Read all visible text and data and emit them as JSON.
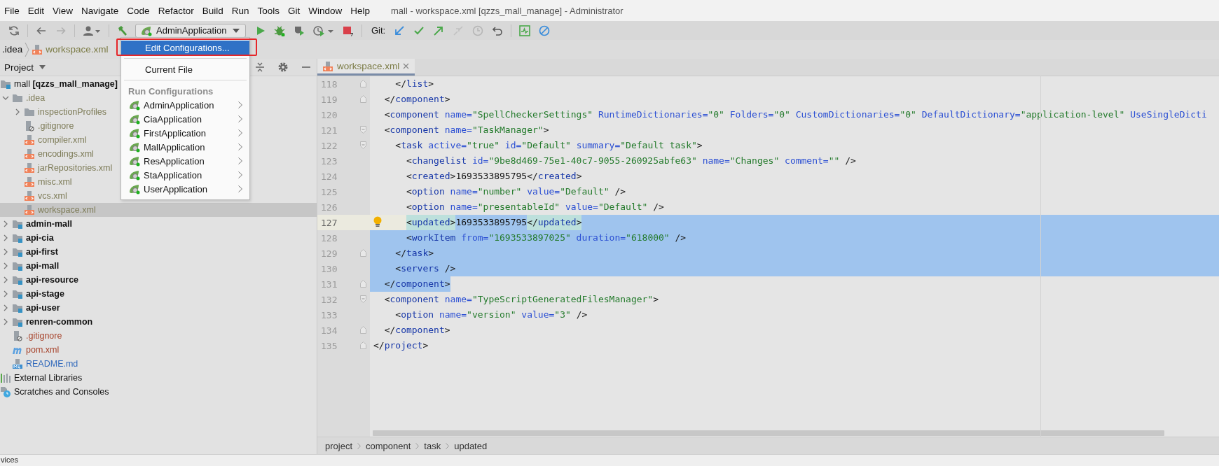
{
  "window": {
    "title": "mall - workspace.xml [qzzs_mall_manage] - Administrator"
  },
  "menu_bar": [
    "File",
    "Edit",
    "View",
    "Navigate",
    "Code",
    "Refactor",
    "Build",
    "Run",
    "Tools",
    "Git",
    "Window",
    "Help"
  ],
  "toolbar": {
    "run_configuration": "AdminApplication",
    "git_label": "Git:"
  },
  "navigation_bar": [
    {
      "kind": "folder",
      "label": ".idea"
    },
    {
      "kind": "xml",
      "label": "workspace.xml"
    }
  ],
  "project_panel": {
    "title": "Project",
    "tree": [
      {
        "kind": "root",
        "label": "mall **[qzzs_mall_manage]**",
        "color": "#111111",
        "expanded": true,
        "selected": false,
        "children": [
          {
            "kind": "folder",
            "label": ".idea",
            "color": "#7d7b57",
            "expanded": true,
            "selected": false,
            "children": [
              {
                "kind": "folder",
                "label": "inspectionProfiles",
                "color": "#7d7b57",
                "expanded": false,
                "selected": false
              },
              {
                "kind": "ignore-file",
                "label": ".gitignore",
                "color": "#7d7b57",
                "selected": false
              },
              {
                "kind": "xml",
                "label": "compiler.xml",
                "color": "#7d7b57",
                "selected": false
              },
              {
                "kind": "xml",
                "label": "encodings.xml",
                "color": "#7d7b57",
                "selected": false
              },
              {
                "kind": "xml",
                "label": "jarRepositories.xml",
                "color": "#7d7b57",
                "selected": false
              },
              {
                "kind": "xml",
                "label": "misc.xml",
                "color": "#7d7b57",
                "selected": false
              },
              {
                "kind": "xml",
                "label": "vcs.xml",
                "color": "#7d7b57",
                "selected": false
              },
              {
                "kind": "xml",
                "label": "workspace.xml",
                "color": "#7d7b57",
                "selected": true
              }
            ]
          },
          {
            "kind": "module",
            "label": "admin-mall",
            "color": "#111111",
            "expanded": false,
            "selected": false
          },
          {
            "kind": "module",
            "label": "api-cia",
            "color": "#111111",
            "expanded": false,
            "selected": false
          },
          {
            "kind": "module",
            "label": "api-first",
            "color": "#111111",
            "expanded": false,
            "selected": false
          },
          {
            "kind": "module",
            "label": "api-mall",
            "color": "#111111",
            "expanded": false,
            "selected": false
          },
          {
            "kind": "module",
            "label": "api-resource",
            "color": "#111111",
            "expanded": false,
            "selected": false
          },
          {
            "kind": "module",
            "label": "api-stage",
            "color": "#111111",
            "expanded": false,
            "selected": false
          },
          {
            "kind": "module",
            "label": "api-user",
            "color": "#111111",
            "expanded": false,
            "selected": false
          },
          {
            "kind": "module",
            "label": "renren-common",
            "color": "#111111",
            "expanded": false,
            "selected": false
          },
          {
            "kind": "ignore-file",
            "label": ".gitignore",
            "color": "#a7432b",
            "selected": false
          },
          {
            "kind": "maven",
            "label": "pom.xml",
            "color": "#a7432b",
            "selected": false
          },
          {
            "kind": "markdown",
            "label": "README.md",
            "color": "#2f68bb",
            "selected": false
          }
        ]
      },
      {
        "kind": "libraries",
        "label": "External Libraries",
        "color": "#111111",
        "selected": false
      },
      {
        "kind": "scratches",
        "label": "Scratches and Consoles",
        "color": "#111111",
        "selected": false
      }
    ]
  },
  "run_menu": {
    "items": [
      {
        "kind": "action",
        "label": "Edit Configurations...",
        "selected": true,
        "outlined": true
      },
      {
        "kind": "separator"
      },
      {
        "kind": "action",
        "label": "Current File",
        "selected": false,
        "outlined": false
      },
      {
        "kind": "separator"
      },
      {
        "kind": "header",
        "label": "Run Configurations"
      },
      {
        "kind": "config",
        "label": "AdminApplication",
        "selected": false,
        "outlined": false
      },
      {
        "kind": "config",
        "label": "CiaApplication",
        "selected": false,
        "outlined": false
      },
      {
        "kind": "config",
        "label": "FirstApplication",
        "selected": false,
        "outlined": false
      },
      {
        "kind": "config",
        "label": "MallApplication",
        "selected": false,
        "outlined": false
      },
      {
        "kind": "config",
        "label": "ResApplication",
        "selected": false,
        "outlined": false
      },
      {
        "kind": "config",
        "label": "StaApplication",
        "selected": false,
        "outlined": false
      },
      {
        "kind": "config",
        "label": "UserApplication",
        "selected": false,
        "outlined": false
      }
    ]
  },
  "editor": {
    "tabs": [
      {
        "label": "workspace.xml",
        "selected": true
      }
    ],
    "lines": [
      {
        "number": "118",
        "kind": "normal",
        "fold_open": false,
        "fold_close": true,
        "current": false,
        "bulb": false,
        "tokens": [
          {
            "kind": "tag",
            "text": "    </list"
          },
          {
            "kind": "punct",
            "text": ">"
          }
        ]
      },
      {
        "number": "119",
        "kind": "normal",
        "fold_open": false,
        "fold_close": true,
        "current": false,
        "bulb": false,
        "tokens": [
          {
            "kind": "tag",
            "text": "  </component"
          },
          {
            "kind": "punct",
            "text": ">"
          }
        ]
      },
      {
        "number": "120",
        "kind": "normal",
        "fold_open": false,
        "fold_close": false,
        "current": false,
        "bulb": false,
        "tokens": [
          {
            "kind": "tag",
            "text": "  <component"
          },
          {
            "kind": "attr",
            "text": " name="
          },
          {
            "kind": "value",
            "text": "\"SpellCheckerSettings\""
          },
          {
            "kind": "attr",
            "text": " RuntimeDictionaries="
          },
          {
            "kind": "value",
            "text": "\"0\""
          },
          {
            "kind": "attr",
            "text": " Folders="
          },
          {
            "kind": "value",
            "text": "\"0\""
          },
          {
            "kind": "attr",
            "text": " CustomDictionaries="
          },
          {
            "kind": "value",
            "text": "\"0\""
          },
          {
            "kind": "attr",
            "text": " DefaultDictionary="
          },
          {
            "kind": "value",
            "text": "\"application-level\""
          },
          {
            "kind": "attr",
            "text": " UseSingleDicti"
          }
        ]
      },
      {
        "number": "121",
        "kind": "normal",
        "fold_open": true,
        "fold_close": false,
        "current": false,
        "bulb": false,
        "tokens": [
          {
            "kind": "tag",
            "text": "  <component"
          },
          {
            "kind": "attr",
            "text": " name="
          },
          {
            "kind": "value",
            "text": "\"TaskManager\""
          },
          {
            "kind": "punct",
            "text": ">"
          }
        ]
      },
      {
        "number": "122",
        "kind": "normal",
        "fold_open": true,
        "fold_close": false,
        "current": false,
        "bulb": false,
        "tokens": [
          {
            "kind": "tag",
            "text": "    <task"
          },
          {
            "kind": "attr",
            "text": " active="
          },
          {
            "kind": "value",
            "text": "\"true\""
          },
          {
            "kind": "attr",
            "text": " id="
          },
          {
            "kind": "value",
            "text": "\"Default\""
          },
          {
            "kind": "attr",
            "text": " summary="
          },
          {
            "kind": "value",
            "text": "\"Default task\""
          },
          {
            "kind": "punct",
            "text": ">"
          }
        ]
      },
      {
        "number": "123",
        "kind": "normal",
        "fold_open": false,
        "fold_close": false,
        "current": false,
        "bulb": false,
        "tokens": [
          {
            "kind": "tag",
            "text": "      <changelist"
          },
          {
            "kind": "attr",
            "text": " id="
          },
          {
            "kind": "value",
            "text": "\"9be8d469-75e1-40c7-9055-260925abfe63\""
          },
          {
            "kind": "attr",
            "text": " name="
          },
          {
            "kind": "value",
            "text": "\"Changes\""
          },
          {
            "kind": "attr",
            "text": " comment="
          },
          {
            "kind": "value",
            "text": "\"\""
          },
          {
            "kind": "punct",
            "text": " />"
          }
        ]
      },
      {
        "number": "124",
        "kind": "normal",
        "fold_open": false,
        "fold_close": false,
        "current": false,
        "bulb": false,
        "tokens": [
          {
            "kind": "tag",
            "text": "      <created"
          },
          {
            "kind": "punct",
            "text": ">"
          },
          {
            "kind": "plain",
            "text": "1693533895795"
          },
          {
            "kind": "tag",
            "text": "</created"
          },
          {
            "kind": "punct",
            "text": ">"
          }
        ]
      },
      {
        "number": "125",
        "kind": "normal",
        "fold_open": false,
        "fold_close": false,
        "current": false,
        "bulb": false,
        "tokens": [
          {
            "kind": "tag",
            "text": "      <option"
          },
          {
            "kind": "attr",
            "text": " name="
          },
          {
            "kind": "value",
            "text": "\"number\""
          },
          {
            "kind": "attr",
            "text": " value="
          },
          {
            "kind": "value",
            "text": "\"Default\""
          },
          {
            "kind": "punct",
            "text": " />"
          }
        ]
      },
      {
        "number": "126",
        "kind": "normal",
        "fold_open": false,
        "fold_close": false,
        "current": false,
        "bulb": false,
        "tokens": [
          {
            "kind": "tag",
            "text": "      <option"
          },
          {
            "kind": "attr",
            "text": " name="
          },
          {
            "kind": "value",
            "text": "\"presentableId\""
          },
          {
            "kind": "attr",
            "text": " value="
          },
          {
            "kind": "value",
            "text": "\"Default\""
          },
          {
            "kind": "punct",
            "text": " />"
          }
        ]
      },
      {
        "number": "127",
        "kind": "selection-start",
        "fold_open": false,
        "fold_close": false,
        "current": true,
        "bulb": true,
        "tokens": [
          {
            "kind": "matched",
            "text": "      <updated>"
          },
          {
            "kind": "plain",
            "text": "1693533895795"
          },
          {
            "kind": "matched",
            "text": "</updated>"
          }
        ]
      },
      {
        "number": "128",
        "kind": "selected",
        "fold_open": false,
        "fold_close": false,
        "current": false,
        "bulb": false,
        "tokens": [
          {
            "kind": "tag",
            "text": "      <workItem"
          },
          {
            "kind": "attr",
            "text": " from="
          },
          {
            "kind": "value",
            "text": "\"1693533897025\""
          },
          {
            "kind": "attr",
            "text": " duration="
          },
          {
            "kind": "value",
            "text": "\"618000\""
          },
          {
            "kind": "punct",
            "text": " />"
          }
        ]
      },
      {
        "number": "129",
        "kind": "selected",
        "fold_open": false,
        "fold_close": true,
        "current": false,
        "bulb": false,
        "tokens": [
          {
            "kind": "tag",
            "text": "    </task"
          },
          {
            "kind": "punct",
            "text": ">"
          }
        ]
      },
      {
        "number": "130",
        "kind": "selected",
        "fold_open": false,
        "fold_close": false,
        "current": false,
        "bulb": false,
        "tokens": [
          {
            "kind": "tag",
            "text": "    <servers"
          },
          {
            "kind": "punct",
            "text": " />"
          }
        ]
      },
      {
        "number": "131",
        "kind": "selection-end",
        "fold_open": false,
        "fold_close": true,
        "current": false,
        "bulb": false,
        "tokens": [
          {
            "kind": "tag",
            "text": "  </component"
          },
          {
            "kind": "punct",
            "text": ">"
          }
        ]
      },
      {
        "number": "132",
        "kind": "normal",
        "fold_open": true,
        "fold_close": false,
        "current": false,
        "bulb": false,
        "tokens": [
          {
            "kind": "tag",
            "text": "  <component"
          },
          {
            "kind": "attr",
            "text": " name="
          },
          {
            "kind": "value",
            "text": "\"TypeScriptGeneratedFilesManager\""
          },
          {
            "kind": "punct",
            "text": ">"
          }
        ]
      },
      {
        "number": "133",
        "kind": "normal",
        "fold_open": false,
        "fold_close": false,
        "current": false,
        "bulb": false,
        "tokens": [
          {
            "kind": "tag",
            "text": "    <option"
          },
          {
            "kind": "attr",
            "text": " name="
          },
          {
            "kind": "value",
            "text": "\"version\""
          },
          {
            "kind": "attr",
            "text": " value="
          },
          {
            "kind": "value",
            "text": "\"3\""
          },
          {
            "kind": "punct",
            "text": " />"
          }
        ]
      },
      {
        "number": "134",
        "kind": "normal",
        "fold_open": false,
        "fold_close": true,
        "current": false,
        "bulb": false,
        "tokens": [
          {
            "kind": "tag",
            "text": "  </component"
          },
          {
            "kind": "punct",
            "text": ">"
          }
        ]
      },
      {
        "number": "135",
        "kind": "normal",
        "fold_open": false,
        "fold_close": true,
        "current": false,
        "bulb": false,
        "tokens": [
          {
            "kind": "tag",
            "text": "</project"
          },
          {
            "kind": "punct",
            "text": ">"
          }
        ]
      }
    ],
    "breadcrumbs": [
      "project",
      "component",
      "task",
      "updated"
    ]
  },
  "status_bar": {
    "text": "vices"
  }
}
